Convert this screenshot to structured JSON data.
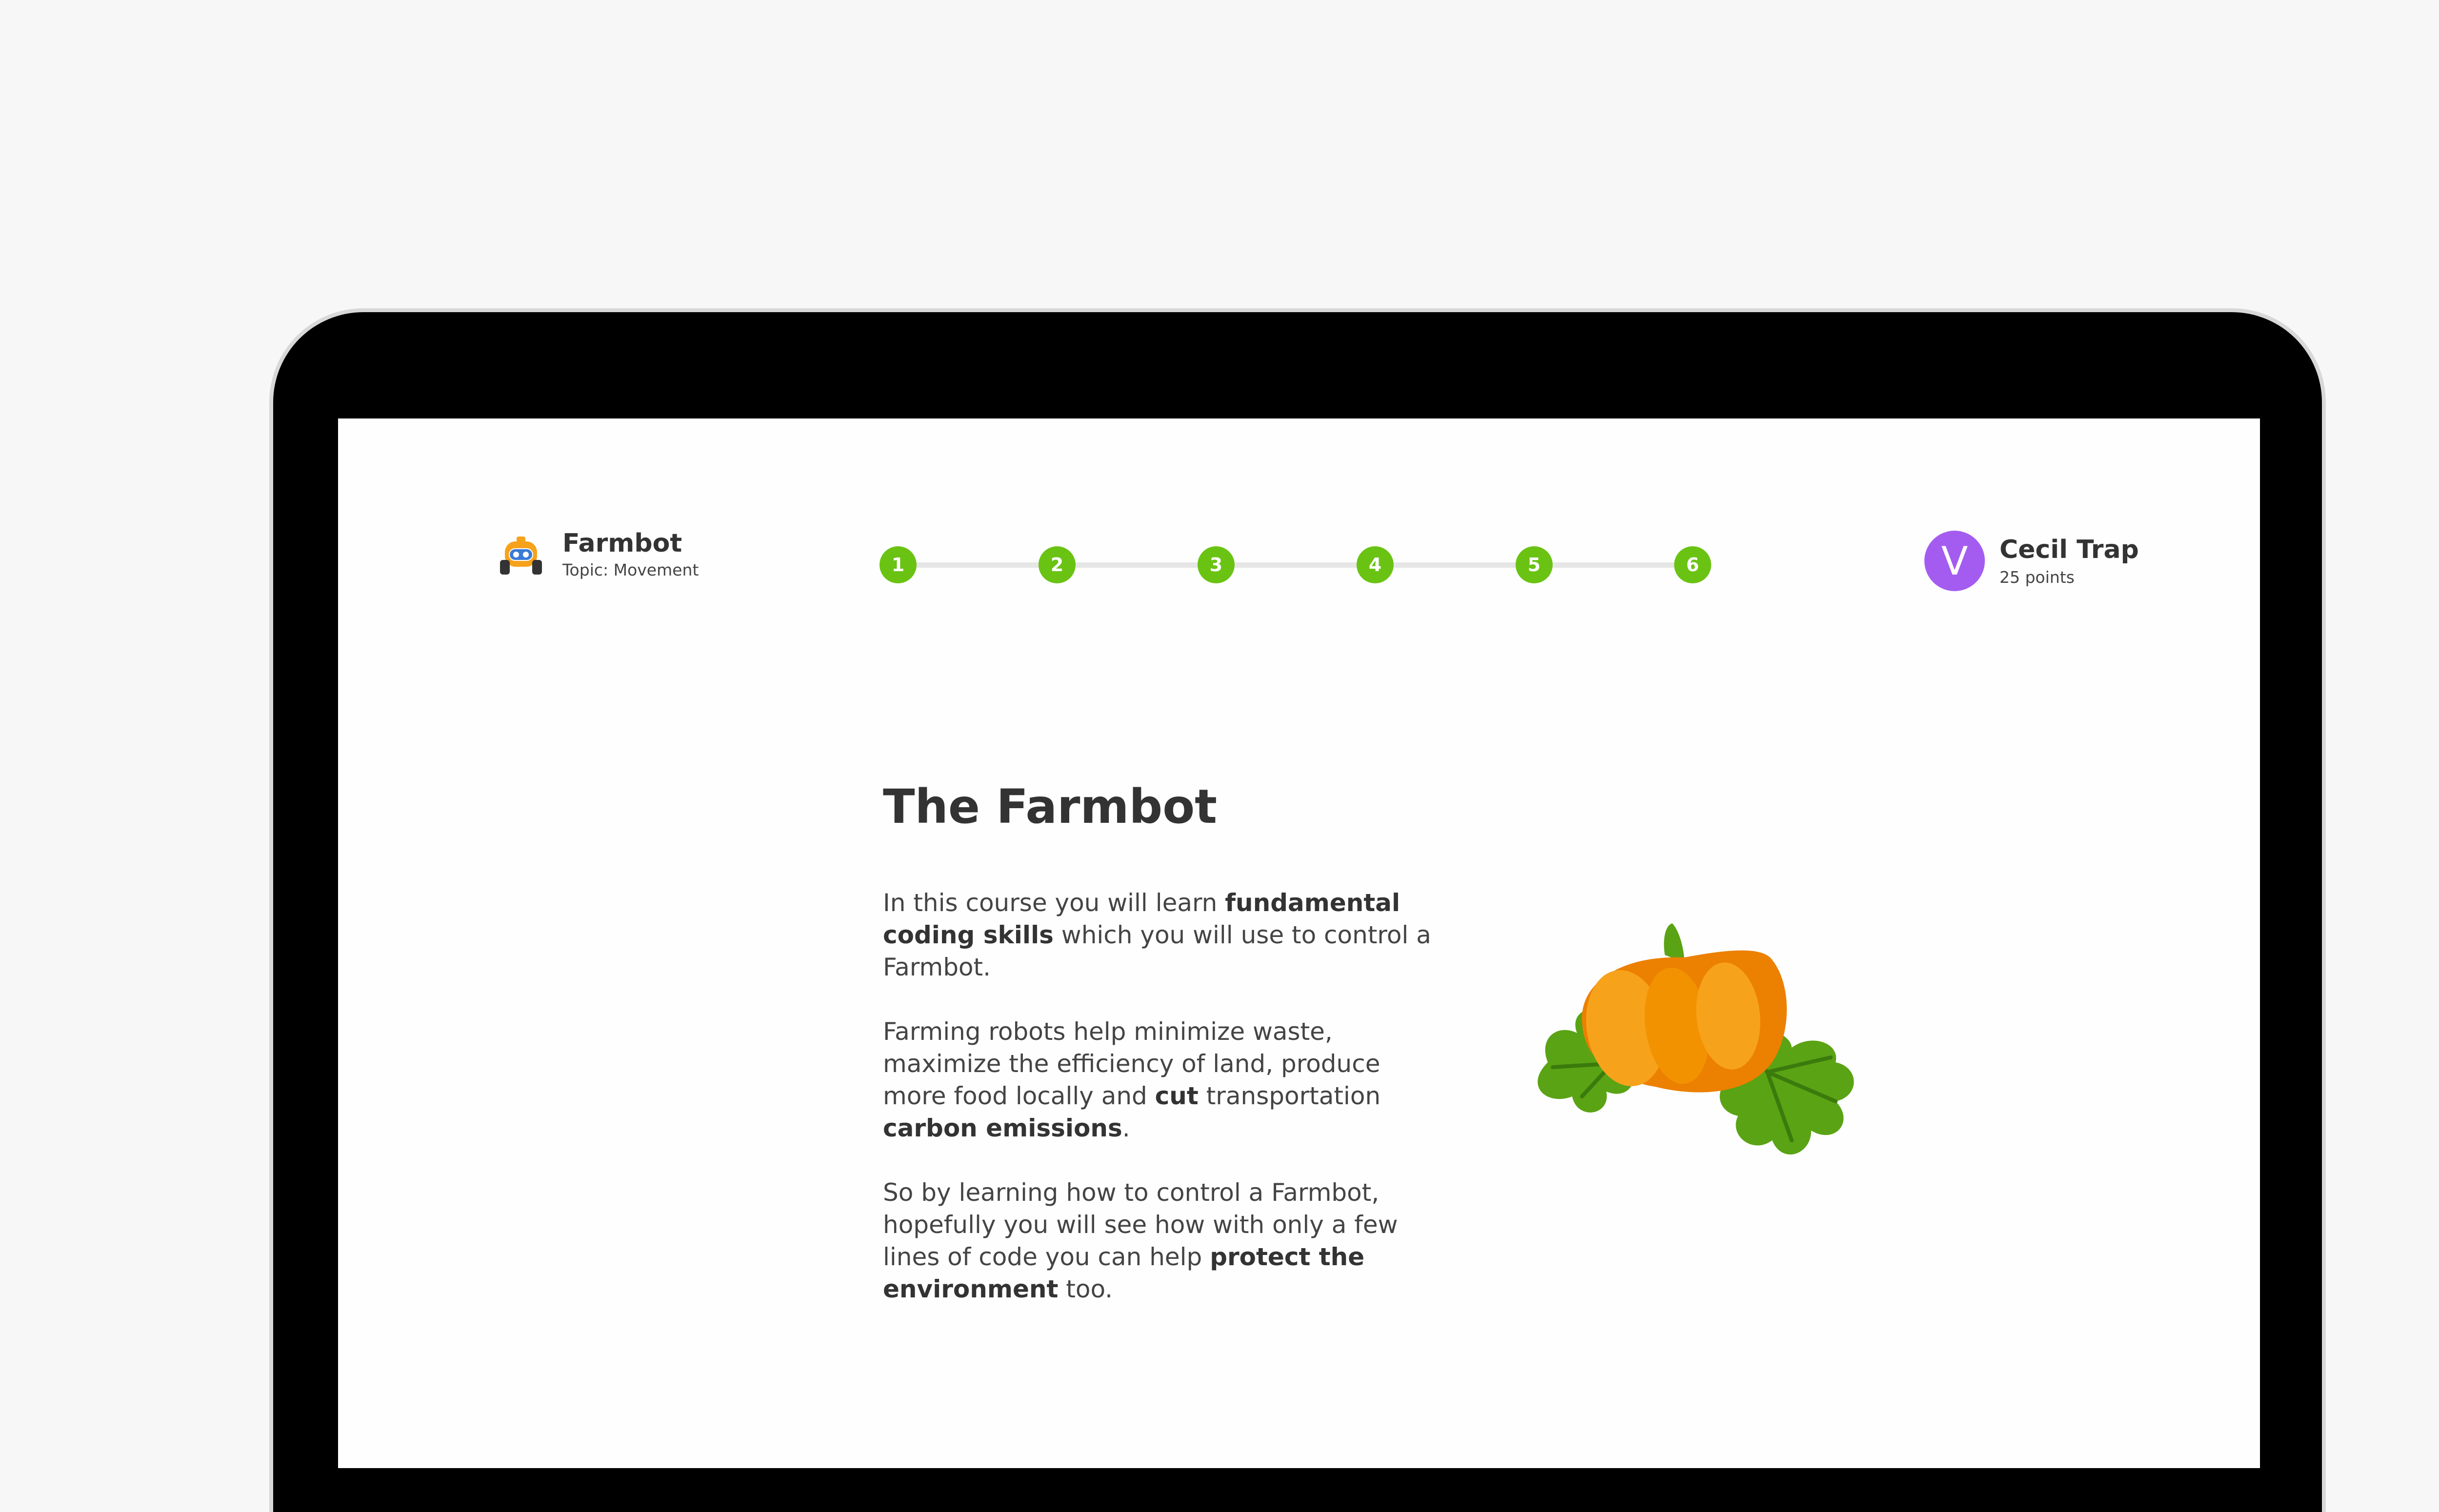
{
  "app": {
    "title": "Farmbot",
    "topic": "Topic: Movement",
    "logo_icon": "farmbot-robot-icon"
  },
  "progress": {
    "steps": [
      "1",
      "2",
      "3",
      "4",
      "5",
      "6"
    ],
    "step_color": "#6ac313",
    "line_color": "#e6e6e6"
  },
  "user": {
    "initial": "V",
    "name": "Cecil Trap",
    "points": "25 points",
    "avatar_color": "#a45cf0"
  },
  "lesson": {
    "title": "The Farmbot",
    "p1": {
      "t1": "In this course you will learn ",
      "b1": "fundamental coding skills",
      "t2": " which you will use to control a Farmbot."
    },
    "p2": {
      "t1": "Farming robots help minimize waste, maximize the efficiency of land, produce more food locally and ",
      "b1": "cut",
      "t2": " transportation ",
      "b2": "carbon emissions",
      "t3": "."
    },
    "p3": {
      "t1": "So by learning how to control a Farmbot, hopefully you will see how with only a few lines of code you can help ",
      "b1": "protect the environment",
      "t2": " too."
    },
    "illustration_icon": "pumpkin-illustration"
  },
  "colors": {
    "background": "#f7f7f7",
    "device_frame": "#000000",
    "screen": "#fefefe",
    "pumpkin_orange": "#f39200",
    "leaf_green": "#5aa314"
  }
}
